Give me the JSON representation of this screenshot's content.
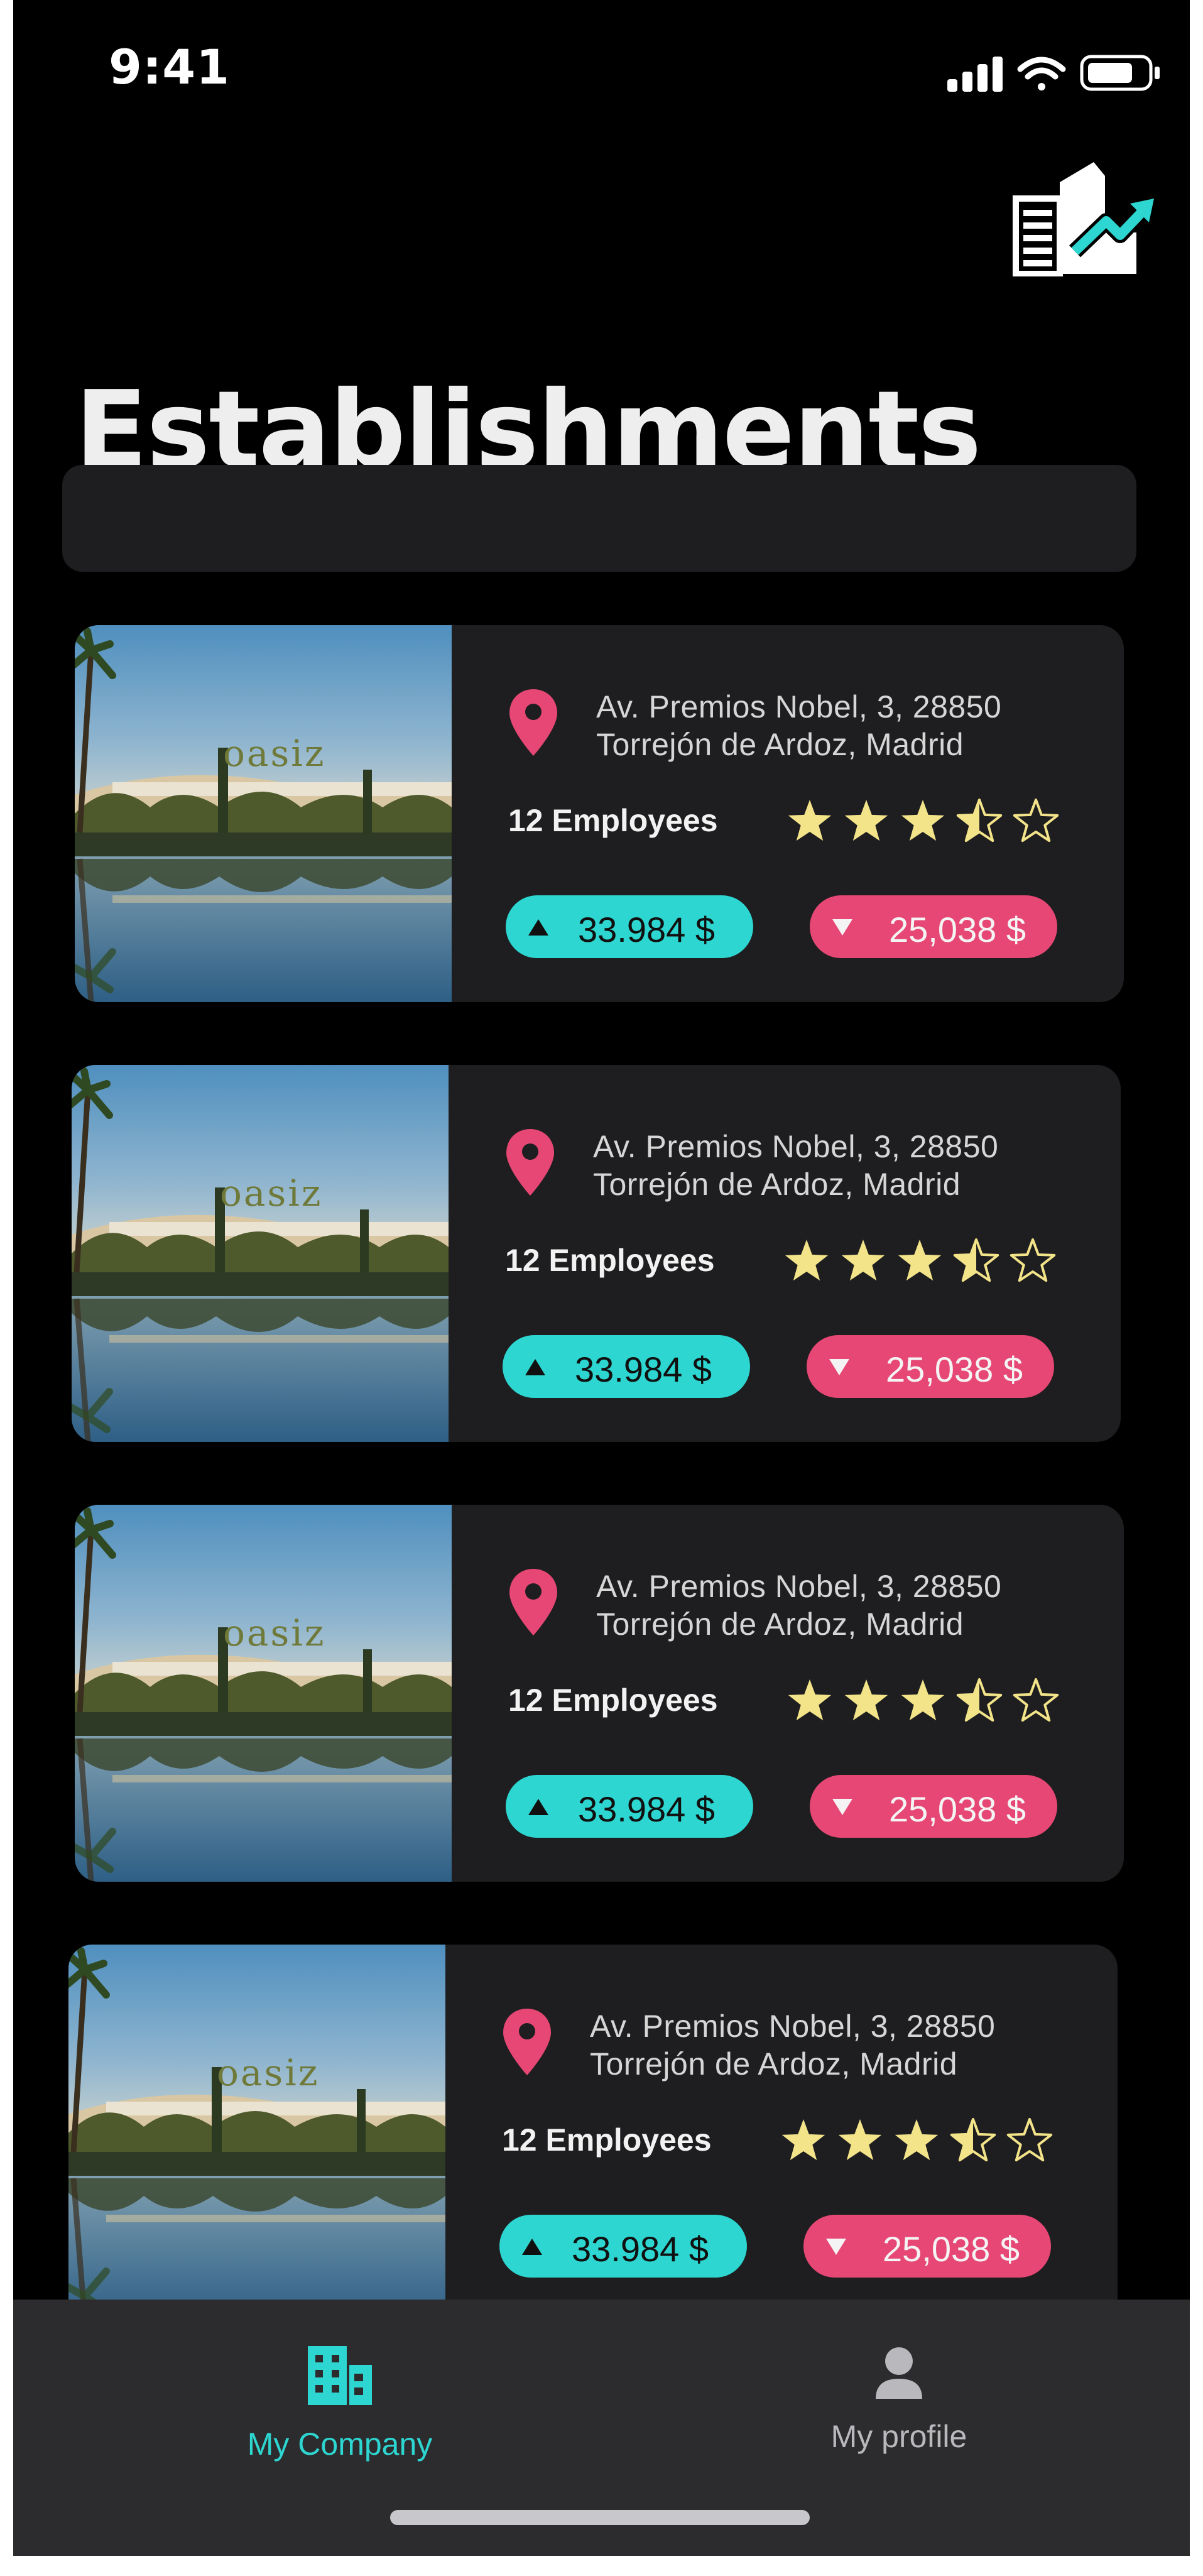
{
  "status_bar": {
    "time": "9:41"
  },
  "page": {
    "title": "Establishments"
  },
  "search": {
    "placeholder": ""
  },
  "establishments": [
    {
      "address_line1": "Av. Premios Nobel, 3, 28850",
      "address_line2": "Torrejón de Ardoz, Madrid",
      "employees": "12 Employees",
      "rating": 3.5,
      "rating_max": 5,
      "income": "33.984 $",
      "expense": "25,038 $",
      "photo_sign": "oasiz"
    },
    {
      "address_line1": "Av. Premios Nobel, 3, 28850",
      "address_line2": "Torrejón de Ardoz, Madrid",
      "employees": "12 Employees",
      "rating": 3.5,
      "rating_max": 5,
      "income": "33.984 $",
      "expense": "25,038 $",
      "photo_sign": "oasiz"
    },
    {
      "address_line1": "Av. Premios Nobel, 3, 28850",
      "address_line2": "Torrejón de Ardoz, Madrid",
      "employees": "12 Employees",
      "rating": 3.5,
      "rating_max": 5,
      "income": "33.984 $",
      "expense": "25,038 $",
      "photo_sign": "oasiz"
    },
    {
      "address_line1": "Av. Premios Nobel, 3, 28850",
      "address_line2": "Torrejón de Ardoz, Madrid",
      "employees": "12 Employees",
      "rating": 3.5,
      "rating_max": 5,
      "income": "33.984 $",
      "expense": "25,038 $",
      "photo_sign": "oasiz"
    }
  ],
  "tab_bar": {
    "tabs": [
      {
        "label": "My Company",
        "icon": "building-icon",
        "active": true
      },
      {
        "label": "My profile",
        "icon": "person-icon",
        "active": false
      }
    ]
  },
  "colors": {
    "background": "#000000",
    "card": "#1e1e20",
    "accent_teal": "#2dd6d0",
    "accent_pink": "#e64774",
    "star": "#f3e48a"
  }
}
